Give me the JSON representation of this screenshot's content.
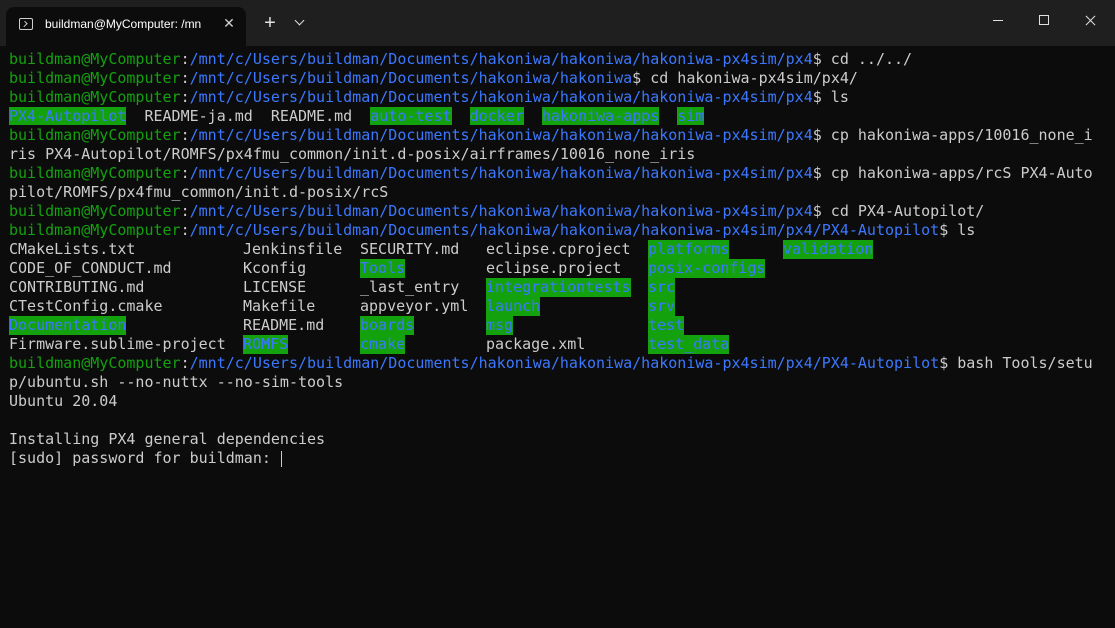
{
  "window": {
    "tab_title": "buildman@MyComputer: /mn",
    "tab_close": "✕",
    "new_tab": "+"
  },
  "colors": {
    "prompt_user": "#13a10e",
    "path": "#3b78ff",
    "text": "#cccccc",
    "dir_highlight_bg": "#13a10e",
    "dir_highlight_fg": "#3b78ff",
    "background": "#0c0c0c"
  },
  "terminal": {
    "prompt_user": "buildman@MyComputer",
    "colon": ":",
    "l1_path": "/mnt/c/Users/buildman/Documents/hakoniwa/hakoniwa/hakoniwa-px4sim/px4",
    "l1_cmd": "$ cd ../../",
    "l2_path": "/mnt/c/Users/buildman/Documents/hakoniwa/hakoniwa",
    "l2_cmd": "$ cd hakoniwa-px4sim/px4/",
    "l3_path": "/mnt/c/Users/buildman/Documents/hakoniwa/hakoniwa/hakoniwa-px4sim/px4",
    "l3_cmd": "$ ls",
    "ls1": {
      "i1": "PX4-Autopilot",
      "i2": "README-ja.md",
      "i3": "README.md",
      "i4": "auto-test",
      "i5": "docker",
      "i6": "hakoniwa-apps",
      "i7": "sim"
    },
    "l5_path": "/mnt/c/Users/buildman/Documents/hakoniwa/hakoniwa/hakoniwa-px4sim/px4",
    "l5_cmd": "$ cp hakoniwa-apps/10016_none_i",
    "l6": "ris PX4-Autopilot/ROMFS/px4fmu_common/init.d-posix/airframes/10016_none_iris",
    "l7_path": "/mnt/c/Users/buildman/Documents/hakoniwa/hakoniwa/hakoniwa-px4sim/px4",
    "l7_cmd": "$ cp hakoniwa-apps/rcS PX4-Auto",
    "l8": "pilot/ROMFS/px4fmu_common/init.d-posix/rcS",
    "l9_path": "/mnt/c/Users/buildman/Documents/hakoniwa/hakoniwa/hakoniwa-px4sim/px4",
    "l9_cmd": "$ cd PX4-Autopilot/",
    "l10_path": "/mnt/c/Users/buildman/Documents/hakoniwa/hakoniwa/hakoniwa-px4sim/px4/PX4-Autopilot",
    "l10_cmd": "$ ls",
    "ls2": {
      "c1": [
        "CMakeLists.txt",
        "CODE_OF_CONDUCT.md",
        "CONTRIBUTING.md",
        "CTestConfig.cmake",
        "Documentation",
        "Firmware.sublime-project"
      ],
      "c2": [
        "Jenkinsfile",
        "Kconfig",
        "LICENSE",
        "Makefile",
        "README.md",
        "ROMFS"
      ],
      "c3": [
        "SECURITY.md",
        "Tools",
        "_last_entry",
        "appveyor.yml",
        "boards",
        "cmake"
      ],
      "c4": [
        "eclipse.cproject",
        "eclipse.project",
        "integrationtests",
        "launch",
        "msg",
        "package.xml"
      ],
      "c5": [
        "platforms",
        "posix-configs",
        "src",
        "srv",
        "test",
        "test_data"
      ],
      "c6": [
        "validation"
      ]
    },
    "l17_path": "/mnt/c/Users/buildman/Documents/hakoniwa/hakoniwa/hakoniwa-px4sim/px4/PX4-Autopilot",
    "l17_cmd": "$ bash Tools/setu",
    "l18": "p/ubuntu.sh --no-nuttx --no-sim-tools",
    "l19": "Ubuntu 20.04",
    "l21": "Installing PX4 general dependencies",
    "l22": "[sudo] password for buildman: "
  }
}
